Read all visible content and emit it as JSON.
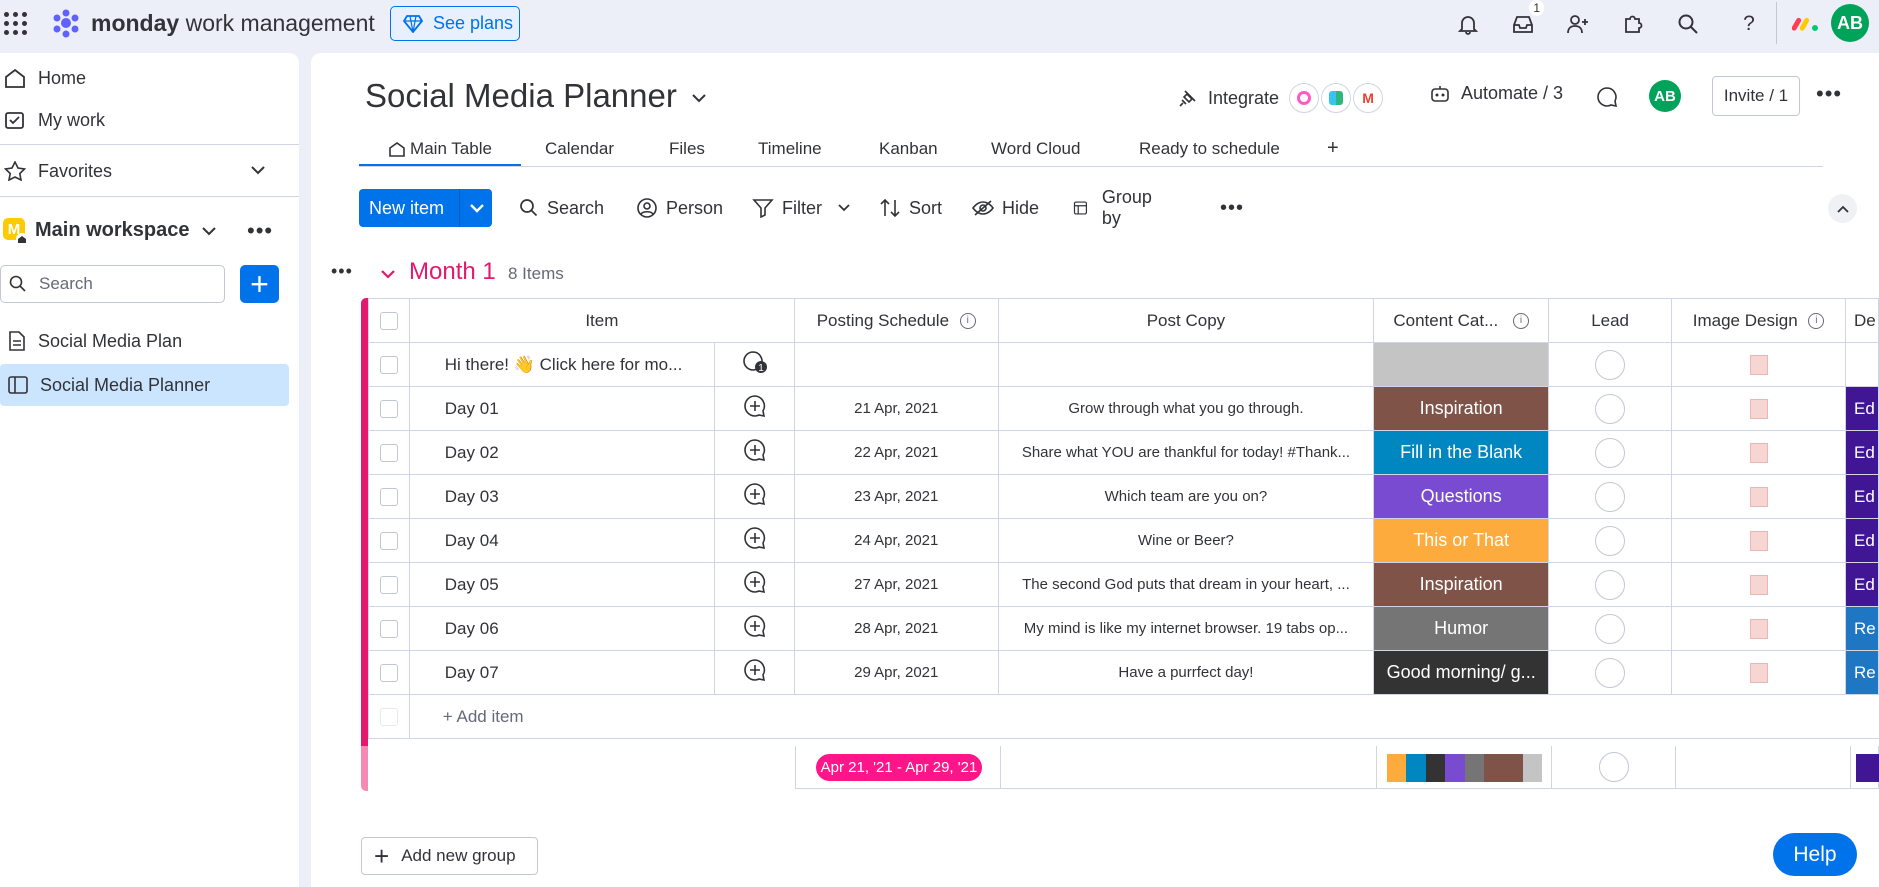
{
  "topbar": {
    "brand_bold": "monday",
    "brand_rest": "work management",
    "see_plans": "See plans",
    "inbox_badge": "1",
    "avatar": "AB"
  },
  "sidebar": {
    "home": "Home",
    "my_work": "My work",
    "favorites": "Favorites",
    "workspace_letter": "M",
    "workspace": "Main workspace",
    "search_placeholder": "Search",
    "boards": [
      {
        "label": "Social Media Plan"
      },
      {
        "label": "Social Media Planner"
      }
    ]
  },
  "board": {
    "title": "Social Media Planner",
    "integrate": "Integrate",
    "automate": "Automate / 3",
    "avatar": "AB",
    "invite": "Invite / 1",
    "tabs": [
      "Main Table",
      "Calendar",
      "Files",
      "Timeline",
      "Kanban",
      "Word Cloud",
      "Ready to schedule",
      "+"
    ]
  },
  "toolbar": {
    "new_item": "New item",
    "search": "Search",
    "person": "Person",
    "filter": "Filter",
    "sort": "Sort",
    "hide": "Hide",
    "group_by": "Group by"
  },
  "group": {
    "title": "Month 1",
    "count": "8 Items",
    "headers": {
      "item": "Item",
      "schedule": "Posting Schedule",
      "copy": "Post Copy",
      "category": "Content Cat...",
      "lead": "Lead",
      "image": "Image Design",
      "extra": "De"
    },
    "rows": [
      {
        "item": "Hi there! 👋 Click here for mo...",
        "date": "",
        "copy": "",
        "category": "",
        "cat_color": "#c4c4c4",
        "extra": "",
        "extra_color": "#ffffff",
        "comments": "1"
      },
      {
        "item": "Day 01",
        "date": "21 Apr, 2021",
        "copy": "Grow through what you go through.",
        "category": "Inspiration",
        "cat_color": "#7f5347",
        "extra": "Ed",
        "extra_color": "#401694",
        "comments": ""
      },
      {
        "item": "Day 02",
        "date": "22 Apr, 2021",
        "copy": "Share what YOU are thankful for today! #Thank...",
        "category": "Fill in the Blank",
        "cat_color": "#0086c0",
        "extra": "Ed",
        "extra_color": "#401694",
        "comments": ""
      },
      {
        "item": "Day 03",
        "date": "23 Apr, 2021",
        "copy": "Which team are you on?",
        "category": "Questions",
        "cat_color": "#784bd1",
        "extra": "Ed",
        "extra_color": "#401694",
        "comments": ""
      },
      {
        "item": "Day 04",
        "date": "24 Apr, 2021",
        "copy": "Wine or Beer?",
        "category": "This or That",
        "cat_color": "#fdab3d",
        "extra": "Ed",
        "extra_color": "#401694",
        "comments": ""
      },
      {
        "item": "Day 05",
        "date": "27 Apr, 2021",
        "copy": "The second God puts that dream in your heart, ...",
        "category": "Inspiration",
        "cat_color": "#7f5347",
        "extra": "Ed",
        "extra_color": "#401694",
        "comments": ""
      },
      {
        "item": "Day 06",
        "date": "28 Apr, 2021",
        "copy": "My mind is like my internet browser. 19 tabs op...",
        "category": "Humor",
        "cat_color": "#757575",
        "extra": "Re",
        "extra_color": "#1f76c2",
        "comments": ""
      },
      {
        "item": "Day 07",
        "date": "29 Apr, 2021",
        "copy": "Have a purrfect day!",
        "category": "Good morning/ g...",
        "cat_color": "#333333",
        "extra": "Re",
        "extra_color": "#1f76c2",
        "comments": ""
      }
    ],
    "add_item": "+ Add item",
    "summary_range": "Apr 21, '21 - Apr 29, '21",
    "summary_colors": [
      "#fdab3d",
      "#0086c0",
      "#333333",
      "#784bd1",
      "#757575",
      "#7f5347",
      "#7f5347",
      "#c4c4c4"
    ]
  },
  "add_group": "Add new group",
  "help": "Help"
}
